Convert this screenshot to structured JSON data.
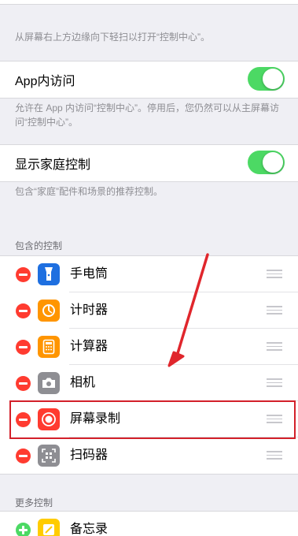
{
  "footnote_top": "从屏幕右上方边缘向下轻扫以打开“控制中心”。",
  "app_access": {
    "label": "App内访问",
    "on": true,
    "note": "允许在 App 内访问“控制中心”。停用后，您仍然可以从主屏幕访问“控制中心”。"
  },
  "home_controls": {
    "label": "显示家庭控制",
    "on": true,
    "note": "包含“家庭”配件和场景的推荐控制。"
  },
  "included": {
    "header": "包含的控制",
    "items": [
      {
        "name": "手电筒",
        "icon": "flashlight-icon",
        "color": "#1e6fe0"
      },
      {
        "name": "计时器",
        "icon": "timer-icon",
        "color": "#ff9500"
      },
      {
        "name": "计算器",
        "icon": "calculator-icon",
        "color": "#ff9500"
      },
      {
        "name": "相机",
        "icon": "camera-icon",
        "color": "#8e8e93"
      },
      {
        "name": "屏幕录制",
        "icon": "screen-record-icon",
        "color": "#ff3b30"
      },
      {
        "name": "扫码器",
        "icon": "qr-scanner-icon",
        "color": "#8e8e93"
      }
    ]
  },
  "more": {
    "header": "更多控制",
    "items": [
      {
        "name": "备忘录",
        "icon": "notes-icon",
        "color": "#ffcc00"
      }
    ]
  },
  "annotation": {
    "highlight_color": "#d3202a",
    "arrow_color": "#e0262c"
  }
}
